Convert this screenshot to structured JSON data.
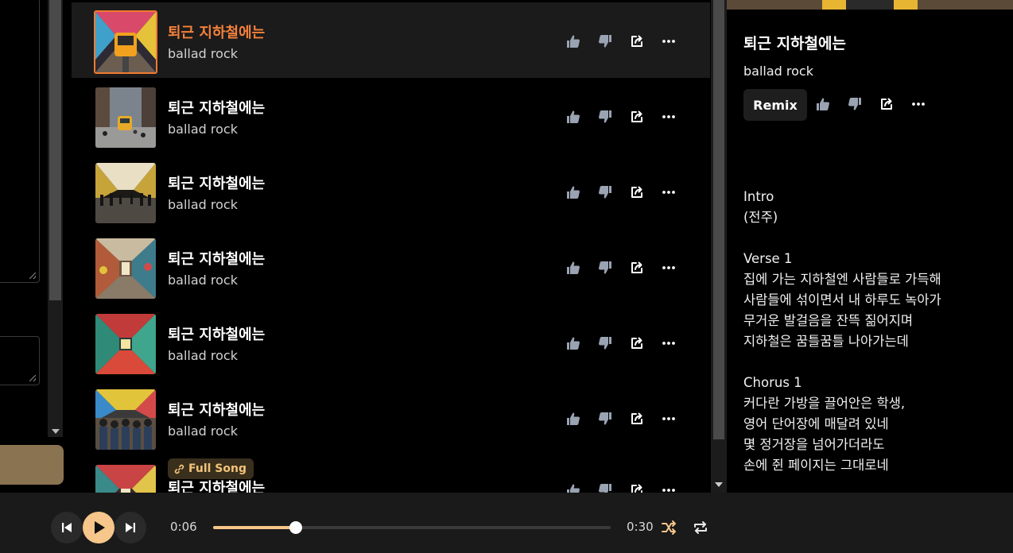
{
  "song_list": {
    "songs": [
      {
        "title": "퇴근 지하철에는",
        "tags": "ballad rock",
        "selected": true
      },
      {
        "title": "퇴근 지하철에는",
        "tags": "ballad rock"
      },
      {
        "title": "퇴근 지하철에는",
        "tags": "ballad rock"
      },
      {
        "title": "퇴근 지하철에는",
        "tags": "ballad rock"
      },
      {
        "title": "퇴근 지하철에는",
        "tags": "ballad rock"
      },
      {
        "title": "퇴근 지하철에는",
        "tags": "ballad rock"
      },
      {
        "title": "퇴근 지하철에는",
        "badge": "Full Song"
      }
    ],
    "icons": [
      "thumbs-up-icon",
      "thumbs-down-icon",
      "share-icon",
      "more-icon"
    ],
    "colors": {
      "selected_title": "#f5813b",
      "selected_border": "#f27a2f",
      "icon_gray": "#9aa3b2",
      "badge_text": "#f2c37a"
    }
  },
  "detail": {
    "title": "퇴근 지하철에는",
    "tags": "ballad rock",
    "remix_label": "Remix",
    "lyrics": "Intro\n(전주)\n\nVerse 1\n집에 가는 지하철엔 사람들로 가득해\n사람들에 섞이면서 내 하루도 녹아가\n무거운 발걸음을 잔뜩 짊어지며\n지하철은 꿈틀꿈틀 나아가는데\n\nChorus 1\n커다란 가방을 끌어안은 학생,\n영어 단어장에 매달려 있네\n몇 정거장을 넘어가더라도\n손에 쥔 페이지는 그대로네"
  },
  "player": {
    "current_time": "0:06",
    "total_time": "0:30",
    "progress": 0.208,
    "accent_color": "#f6c68a"
  }
}
